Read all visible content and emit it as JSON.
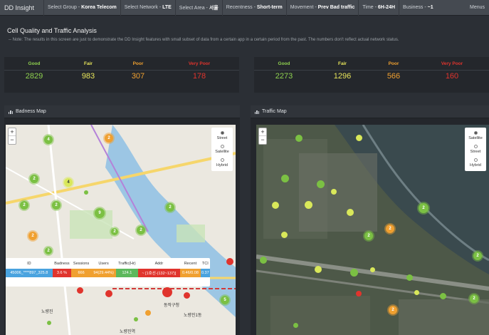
{
  "app": {
    "title": "DD Insight"
  },
  "filters": [
    {
      "label": "Select Group",
      "value": "Korea Telecom"
    },
    {
      "label": "Select Network",
      "value": "LTE"
    },
    {
      "label": "Select Area",
      "value": "서울"
    },
    {
      "label": "Recentness",
      "value": "Short-term"
    },
    {
      "label": "Movement",
      "value": "Prev Bad traffic"
    },
    {
      "label": "Time",
      "value": "6H-24H"
    },
    {
      "label": "Business",
      "value": "~1"
    }
  ],
  "menus_label": "Menus",
  "page": {
    "title": "Cell Quality and Traffic Analysis",
    "note": "-- Note: The results in this screen are just to demonstrate the DD Insight features with small subset of data from a certain app in a certain period from the past. The numbers don't reflect actual network status."
  },
  "colors": {
    "good": "#8fd14f",
    "fair": "#e8e55a",
    "poor": "#f0a030",
    "very_poor": "#e0342d"
  },
  "stats_left": [
    {
      "label": "Good",
      "value": "2829"
    },
    {
      "label": "Fair",
      "value": "983"
    },
    {
      "label": "Poor",
      "value": "307"
    },
    {
      "label": "Very Poor",
      "value": "178"
    }
  ],
  "stats_right": [
    {
      "label": "Good",
      "value": "2273"
    },
    {
      "label": "Fair",
      "value": "1296"
    },
    {
      "label": "Poor",
      "value": "566"
    },
    {
      "label": "Very Poor",
      "value": "160"
    }
  ],
  "panels": {
    "badness_title": "Badness Map",
    "traffic_title": "Traffic Map"
  },
  "map_controls": {
    "zoom_in": "+",
    "zoom_out": "−"
  },
  "layers_left": {
    "street": "Street",
    "satellite": "Satellite",
    "hybrid": "Hybrid",
    "selected": "Street"
  },
  "layers_right": {
    "satellite": "Satellite",
    "street": "Street",
    "hybrid": "Hybrid",
    "selected": "Satellite"
  },
  "badness_clusters": [
    "4",
    "2",
    "2",
    "4",
    "2",
    "2",
    "2",
    "9",
    "2",
    "2",
    "2",
    "5",
    "2"
  ],
  "traffic_clusters": [
    "2",
    "2",
    "2",
    "2",
    "2",
    "2"
  ],
  "tooltip": {
    "headers": [
      "ID",
      "Badness",
      "Sessions",
      "Users",
      "Traffic(Hr)",
      "Addr",
      "Recent",
      "TCI"
    ],
    "row": [
      "45006_****897_325.8",
      "3.6 %",
      "666",
      "94(29.44%)",
      "124.1",
      "~ [1호선-(132~137)]",
      "0.46/0.08",
      "0.37"
    ]
  },
  "map_labels": [
    "노량진",
    "동작구청",
    "노량진1동",
    "노량진역"
  ]
}
